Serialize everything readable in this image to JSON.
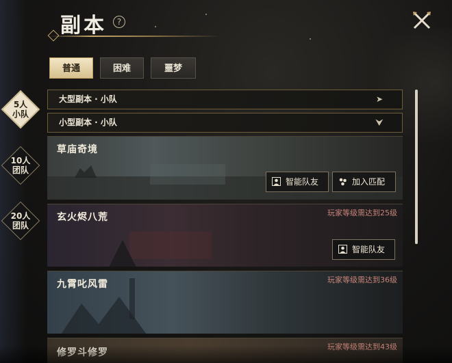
{
  "header": {
    "title": "副本",
    "help_glyph": "?"
  },
  "difficulty_tabs": [
    {
      "label": "普通",
      "active": true
    },
    {
      "label": "困难",
      "active": false
    },
    {
      "label": "噩梦",
      "active": false
    }
  ],
  "modes": [
    {
      "line1": "5人",
      "line2": "小队",
      "active": true
    },
    {
      "line1": "10人",
      "line2": "团队",
      "active": false
    },
    {
      "line1": "20人",
      "line2": "团队",
      "active": false
    }
  ],
  "categories": [
    {
      "label": "大型副本 · 小队",
      "arrow": "➤"
    },
    {
      "label": "小型副本 · 小队",
      "arrow": "⮟"
    }
  ],
  "dungeons": [
    {
      "name": "草庙奇境",
      "requirement": "",
      "buttons": [
        "智能队友",
        "加入匹配"
      ]
    },
    {
      "name": "玄火烬八荒",
      "requirement": "玩家等级需达到25级",
      "buttons": [
        "智能队友"
      ]
    },
    {
      "name": "九霄叱风雷",
      "requirement": "玩家等级需达到36级",
      "buttons": []
    },
    {
      "name": "修罗斗修罗",
      "requirement": "玩家等级需达到43级",
      "buttons": []
    }
  ],
  "colors": {
    "accent_gold": "#c7a86a",
    "requirement_red": "#c9857b",
    "active_tab": "#f3e6c4"
  },
  "icons": {
    "close": "close-x-icon",
    "help": "question-icon",
    "teammate": "portrait-icon",
    "match": "group-icon"
  }
}
